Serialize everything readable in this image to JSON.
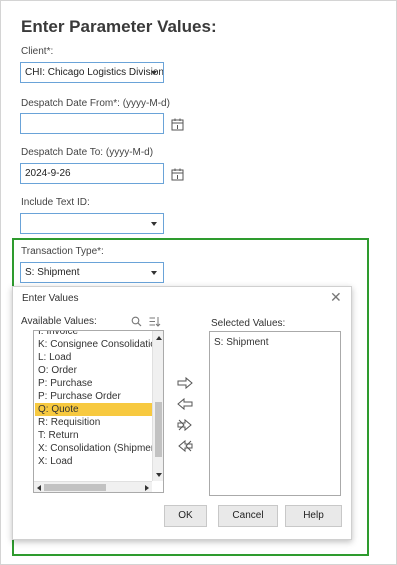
{
  "page": {
    "title": "Enter Parameter Values:"
  },
  "client": {
    "label": "Client*:",
    "value": "CHI: Chicago Logistics Division"
  },
  "despatch_from": {
    "label": "Despatch Date From*: (yyyy-M-d)",
    "value": ""
  },
  "despatch_to": {
    "label": "Despatch Date To: (yyyy-M-d)",
    "value": "2024-9-26"
  },
  "include_text_id": {
    "label": "Include Text ID:",
    "value": ""
  },
  "transaction_type": {
    "label": "Transaction Type*:",
    "value": "S: Shipment"
  },
  "dialog": {
    "title": "Enter Values",
    "close_icon": "close-icon",
    "available_label": "Available Values:",
    "selected_label": "Selected Values:",
    "available_items": [
      "I: Invoice",
      "K: Consignee Consolidation",
      "L: Load",
      "O: Order",
      "P: Purchase",
      "P: Purchase Order",
      "Q: Quote",
      "R: Requisition",
      "T: Return",
      "X: Consolidation (Shipment)",
      "X: Load"
    ],
    "active_item": "Q: Quote",
    "selected_items": [
      "S: Shipment"
    ],
    "buttons": {
      "ok": "OK",
      "cancel": "Cancel",
      "help": "Help"
    }
  },
  "colors": {
    "highlight": "#f7c940",
    "group_border": "#2e9b2e",
    "field_border": "#6aa3d8"
  }
}
